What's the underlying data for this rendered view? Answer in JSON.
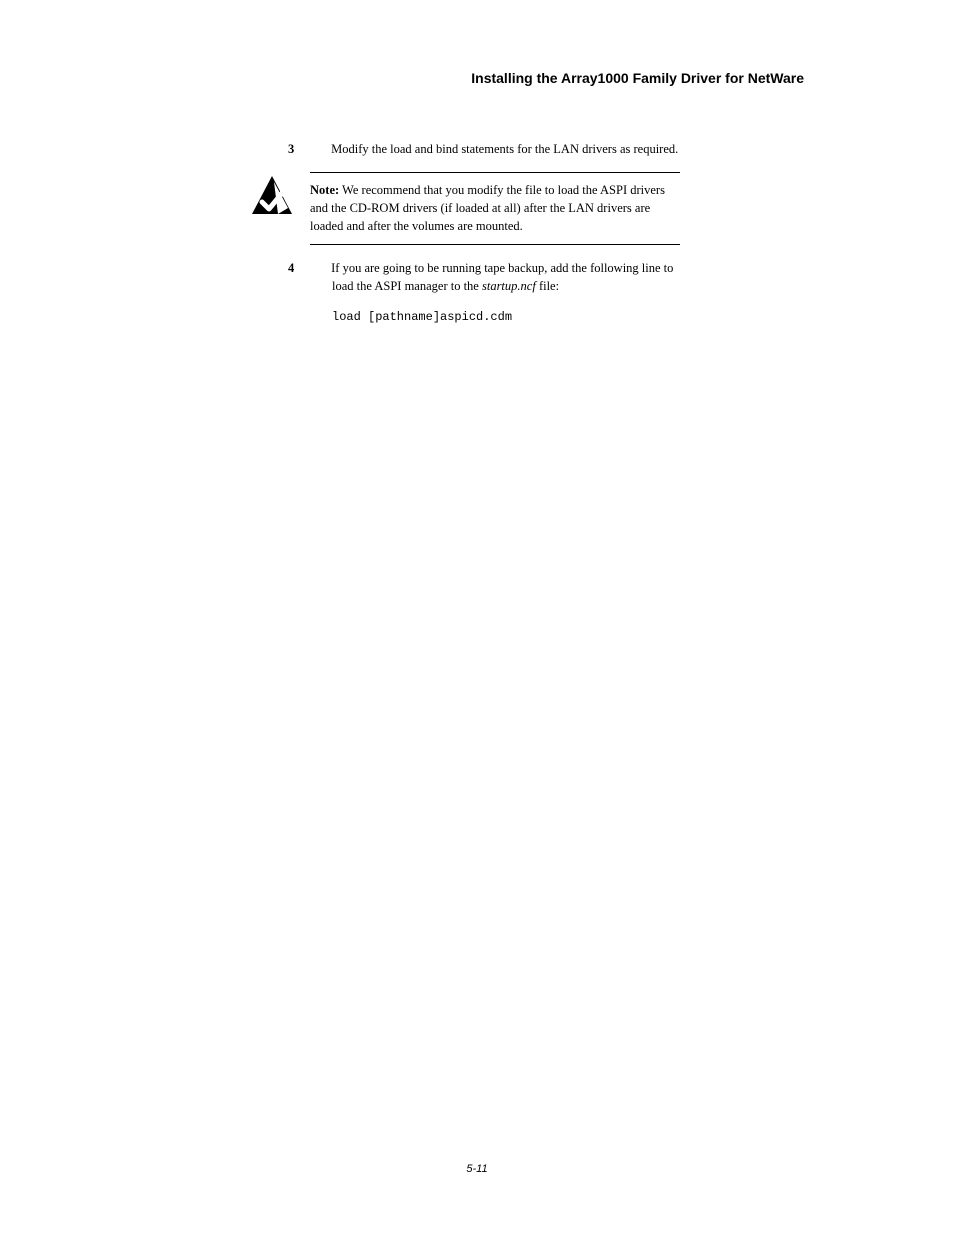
{
  "header": {
    "title": "Installing the Array1000 Family Driver for NetWare"
  },
  "content": {
    "step3": {
      "num": "3",
      "text": " Modify the load and bind statements for the LAN drivers as required."
    },
    "note": {
      "label": "Note:",
      "text": " We recommend that you modify the file to load the ASPI drivers and the CD-ROM drivers (if loaded at all) after the LAN drivers are loaded and after the volumes are mounted."
    },
    "step4": {
      "num": "4",
      "text_before": " If you are going to be running tape backup, add the following line to load the ASPI manager to the ",
      "filename": "startup.ncf",
      "text_after": " file:"
    },
    "code": "load [pathname]aspicd.cdm"
  },
  "footer": {
    "page_number": "5-11"
  }
}
